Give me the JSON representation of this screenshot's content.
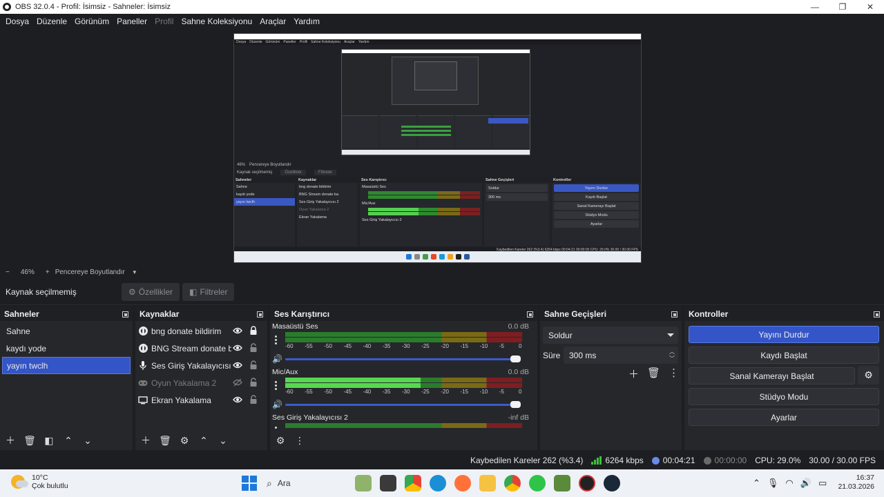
{
  "window": {
    "title": "OBS 32.0.4 - Profil: İsimsiz - Sahneler: İsimsiz"
  },
  "menu": [
    "Dosya",
    "Düzenle",
    "Görünüm",
    "Paneller",
    "Profil",
    "Sahne Koleksiyonu",
    "Araçlar",
    "Yardım"
  ],
  "preview": {
    "mini_menu": [
      "Dosya",
      "Düzenle",
      "Görünüm",
      "Paneller",
      "Profil",
      "Sahne Koleksiyonu",
      "Araçlar",
      "Yardım"
    ],
    "mini_panels": {
      "scenes_title": "Sahneler",
      "scenes": [
        "Sahne",
        "kaydı yode",
        "yayın twclh"
      ],
      "sources_title": "Kaynaklar",
      "sources": [
        "bng donate bildirim",
        "BNG Stream donate ba",
        "Ses Giriş Yakalayıcısı 2",
        "Oyun Yakalama 2",
        "Ekran Yakalama"
      ],
      "mixer_title": "Ses Karıştırıcı",
      "mixer": [
        "Masaüstü Ses",
        "Mic/Aux",
        "Ses Giriş Yakalayıcısı 2"
      ],
      "transitions_title": "Sahne Geçişleri",
      "transition": "Soldur",
      "duration": "300 ms",
      "controls_title": "Kontroller",
      "controls": [
        "Yayını Durdur",
        "Kaydı Başlat",
        "Sanal Kamerayı Başlat",
        "Stüdyo Modu",
        "Ayarlar"
      ],
      "context": "Kaynak seçilmemiş",
      "status": "Kaybedilen Kareler 262 (%3.4)   6264 kbps   00:04:21   00:00:00   CPU: 29.0%   30.00 / 30.00 FPS"
    }
  },
  "zoom": {
    "minus": "−",
    "value": "46%",
    "plus": "+",
    "fit": "Pencereye Boyutlandır"
  },
  "context": {
    "no_source": "Kaynak seçilmemiş",
    "properties": "Özellikler",
    "filters": "Filtreler"
  },
  "scenes": {
    "title": "Sahneler",
    "items": [
      {
        "name": "Sahne",
        "selected": false
      },
      {
        "name": "kaydı yode",
        "selected": false
      },
      {
        "name": "yayın twclh",
        "selected": true
      }
    ]
  },
  "sources": {
    "title": "Kaynaklar",
    "items": [
      {
        "name": "bng donate bildirim",
        "icon": "browser-icon",
        "visible": true,
        "locked": true
      },
      {
        "name": "BNG Stream donate ba",
        "icon": "browser-icon",
        "visible": true,
        "locked": false
      },
      {
        "name": "Ses Giriş Yakalayıcısı 2",
        "icon": "microphone-icon",
        "visible": true,
        "locked": false
      },
      {
        "name": "Oyun Yakalama 2",
        "icon": "gamepad-icon",
        "visible": false,
        "locked": false
      },
      {
        "name": "Ekran Yakalama",
        "icon": "monitor-icon",
        "visible": true,
        "locked": false
      }
    ]
  },
  "mixer": {
    "title": "Ses Karıştırıcı",
    "scale": [
      "-60",
      "-55",
      "-50",
      "-45",
      "-40",
      "-35",
      "-30",
      "-25",
      "-20",
      "-15",
      "-10",
      "-5",
      "0"
    ],
    "channels": [
      {
        "name": "Masaüstü Ses",
        "db": "0.0 dB",
        "level": 0,
        "volume": 1.0
      },
      {
        "name": "Mic/Aux",
        "db": "0.0 dB",
        "level": 0.57,
        "volume": 1.0
      },
      {
        "name": "Ses Giriş Yakalayıcısı 2",
        "db": "-inf dB",
        "level": 0,
        "volume": 1.0
      }
    ]
  },
  "transitions": {
    "title": "Sahne Geçişleri",
    "selected": "Soldur",
    "duration_label": "Süre",
    "duration": "300 ms"
  },
  "controls": {
    "title": "Kontroller",
    "stop_stream": "Yayını Durdur",
    "start_record": "Kaydı Başlat",
    "start_vcam": "Sanal Kamerayı Başlat",
    "studio_mode": "Stüdyo Modu",
    "settings": "Ayarlar"
  },
  "status": {
    "dropped": "Kaybedilen Kareler 262 (%3.4)",
    "bitrate": "6264 kbps",
    "stream_time": "00:04:21",
    "record_time": "00:00:00",
    "cpu": "CPU: 29.0%",
    "fps": "30.00 / 30.00 FPS"
  },
  "taskbar": {
    "temp": "10°C",
    "weather": "Çok bulutlu",
    "search": "Ara",
    "time": "16:37",
    "date": "21.03.2026"
  },
  "colors": {
    "accent": "#3455c7",
    "meter_green": "#2a7c2c",
    "meter_lit": "#56d94f",
    "meter_yellow": "#7a6a16",
    "meter_red": "#7e1e22"
  }
}
